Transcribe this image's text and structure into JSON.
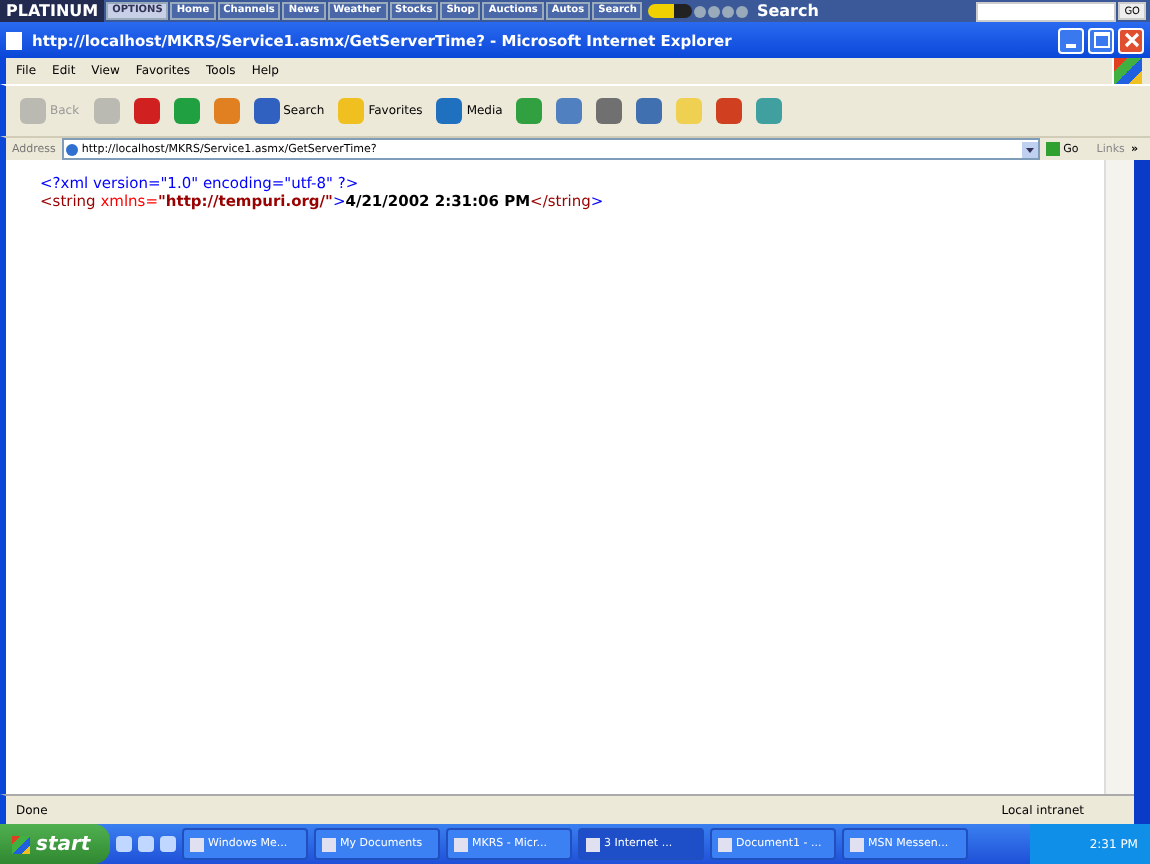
{
  "top_bar": {
    "logo": "PLATINUM",
    "options": "OPTIONS",
    "links": [
      "Home",
      "Channels",
      "News",
      "Weather",
      "Stocks",
      "Shop",
      "Auctions",
      "Autos",
      "Search"
    ],
    "search_label": "Search",
    "go": "GO"
  },
  "window": {
    "title": "http://localhost/MKRS/Service1.asmx/GetServerTime? - Microsoft Internet Explorer"
  },
  "menu": [
    "File",
    "Edit",
    "View",
    "Favorites",
    "Tools",
    "Help"
  ],
  "toolbar": [
    {
      "kind": "back",
      "label": "Back",
      "disabled": true
    },
    {
      "kind": "forward",
      "disabled": true
    },
    {
      "kind": "stop",
      "disabled": false
    },
    {
      "kind": "refresh",
      "disabled": false
    },
    {
      "kind": "home",
      "disabled": false
    },
    {
      "kind": "search",
      "label": "Search",
      "disabled": false
    },
    {
      "kind": "favorites",
      "label": "Favorites",
      "disabled": false
    },
    {
      "kind": "media",
      "label": "Media",
      "disabled": false
    },
    {
      "kind": "history",
      "disabled": false
    },
    {
      "kind": "mail",
      "disabled": false
    },
    {
      "kind": "print",
      "disabled": false
    },
    {
      "kind": "edit",
      "disabled": false
    },
    {
      "kind": "note",
      "disabled": false
    },
    {
      "kind": "messenger",
      "disabled": false
    },
    {
      "kind": "people",
      "disabled": false
    }
  ],
  "address": {
    "label": "Address",
    "value": "http://localhost/MKRS/Service1.asmx/GetServerTime?",
    "go": "Go",
    "links": "Links",
    "more": "»"
  },
  "document": {
    "lines": [
      [
        {
          "kind": "pi",
          "text": "<?xml version=\"1.0\" encoding=\"utf-8\" ?>"
        }
      ],
      [
        {
          "kind": "tag",
          "text": "<string"
        },
        {
          "kind": "attr",
          "text": " xmlns="
        },
        {
          "kind": "value",
          "text": "\"http://tempuri.org/\""
        },
        {
          "kind": "punct",
          "text": ">"
        },
        {
          "kind": "text",
          "text": "4/21/2002 2:31:06 PM"
        },
        {
          "kind": "tag",
          "text": "</string"
        },
        {
          "kind": "punct",
          "text": ">"
        }
      ]
    ]
  },
  "status_bar": {
    "text": "Done",
    "zone": "Local intranet"
  },
  "taskbar": {
    "start": "start",
    "tasks": [
      {
        "label": "Windows Me...",
        "selected": false
      },
      {
        "label": "My Documents",
        "selected": false
      },
      {
        "label": "MKRS - Micr...",
        "selected": false
      },
      {
        "label": "3 Internet ...",
        "selected": true
      },
      {
        "label": "Document1 - ...",
        "selected": false
      },
      {
        "label": "MSN Messen...",
        "selected": false
      }
    ],
    "clock": "2:31 PM"
  }
}
